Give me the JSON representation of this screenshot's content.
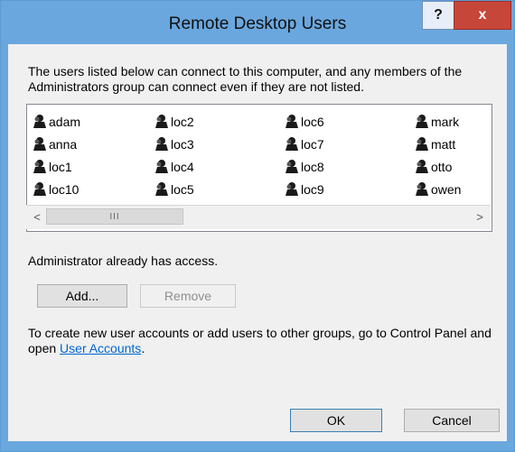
{
  "window": {
    "title": "Remote Desktop Users",
    "help_label": "?",
    "close_label": "x"
  },
  "intro_text": "The users listed below can connect to this computer, and any members of the Administrators group can connect even if they are not listed.",
  "users": [
    [
      "adam",
      "anna",
      "loc1",
      "loc10"
    ],
    [
      "loc2",
      "loc3",
      "loc4",
      "loc5"
    ],
    [
      "loc6",
      "loc7",
      "loc8",
      "loc9"
    ],
    [
      "mark",
      "matt",
      "otto",
      "owen"
    ]
  ],
  "user_icon": "user-group-icon",
  "scrollbar": {
    "left_arrow": "<",
    "right_arrow": ">",
    "thumb_grip": "III"
  },
  "access_text": "Administrator already has access.",
  "buttons": {
    "add": "Add...",
    "remove": "Remove",
    "ok": "OK",
    "cancel": "Cancel"
  },
  "info": {
    "text_before": "To create new user accounts or add users to other groups, go to Control Panel and open ",
    "link_text": "User Accounts",
    "text_after": "."
  },
  "colors": {
    "titlebar": "#6aa7de",
    "close": "#c7463a",
    "link": "#0066cc"
  }
}
